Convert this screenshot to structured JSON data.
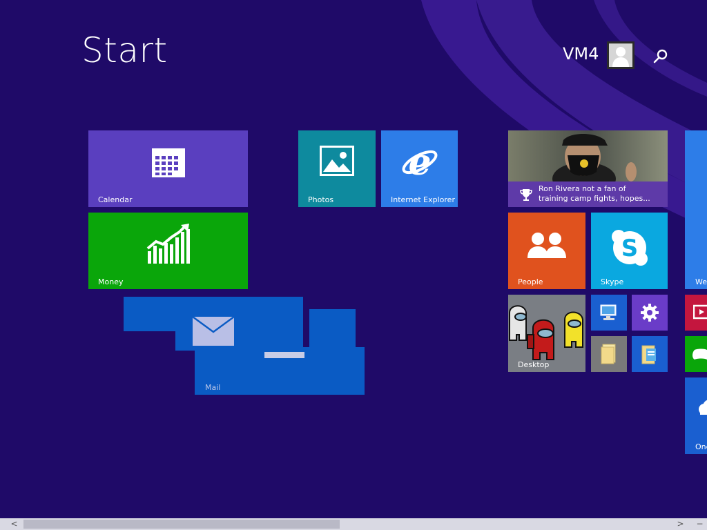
{
  "header": {
    "title": "Start",
    "user_name": "VM4"
  },
  "tiles": {
    "calendar": {
      "label": "Calendar",
      "color": "#5a3fbf"
    },
    "money": {
      "label": "Money",
      "color": "#0aa60a"
    },
    "mail": {
      "label": "Mail",
      "color": "#0a5bc4"
    },
    "photos": {
      "label": "Photos",
      "color": "#0e8a9e"
    },
    "internet_explorer": {
      "label": "Internet Explorer",
      "color": "#2d7de8"
    },
    "sports": {
      "headline_line1": "Ron Rivera not a fan of",
      "headline_line2": "training camp fights, hopes..."
    },
    "people": {
      "label": "People",
      "color": "#e0521e"
    },
    "skype": {
      "label": "Skype",
      "color": "#0aa8e0"
    },
    "desktop": {
      "label": "Desktop"
    },
    "weather": {
      "label": "We"
    },
    "onedrive": {
      "label": "One"
    }
  },
  "icons": {
    "calendar": "calendar-icon",
    "money": "chart-icon",
    "mail": "envelope-icon",
    "photos": "picture-icon",
    "ie": "ie-logo-icon",
    "people": "people-icon",
    "skype": "skype-icon",
    "computer": "computer-icon",
    "settings": "gear-icon",
    "file_explorer": "folder-icon",
    "documents": "documents-icon",
    "video": "video-icon",
    "games": "gamepad-icon",
    "onedrive": "cloud-icon",
    "search": "search-icon",
    "avatar": "user-icon"
  },
  "scrollbar": {
    "left_arrow": "<",
    "right_arrow": ">",
    "minus": "−"
  }
}
